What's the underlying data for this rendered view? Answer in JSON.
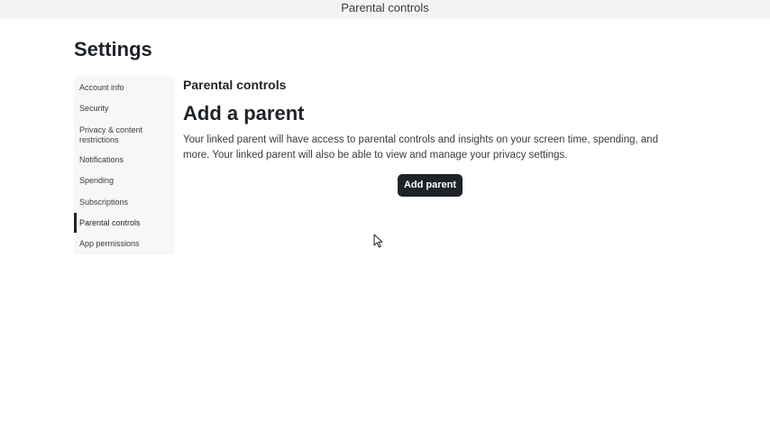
{
  "topbar": {
    "title": "Parental controls"
  },
  "page": {
    "title": "Settings"
  },
  "sidebar": {
    "items": [
      {
        "label": "Account info"
      },
      {
        "label": "Security"
      },
      {
        "label": "Privacy & content restrictions"
      },
      {
        "label": "Notifications"
      },
      {
        "label": "Spending"
      },
      {
        "label": "Subscriptions"
      },
      {
        "label": "Parental controls",
        "active": true
      },
      {
        "label": "App permissions"
      }
    ]
  },
  "main": {
    "section_title": "Parental controls",
    "heading": "Add a parent",
    "description": "Your linked parent will have access to parental controls and insights on your screen time, spending, and more. Your linked parent will also be able to view and manage your privacy settings.",
    "add_button_label": "Add parent"
  },
  "colors": {
    "accent": "#1f2328",
    "sidebar_bg": "#f7f7f8",
    "topbar_bg": "#f2f4f5",
    "text_secondary": "#393b3d"
  },
  "icons": {
    "cursor": "mouse-pointer-icon"
  }
}
